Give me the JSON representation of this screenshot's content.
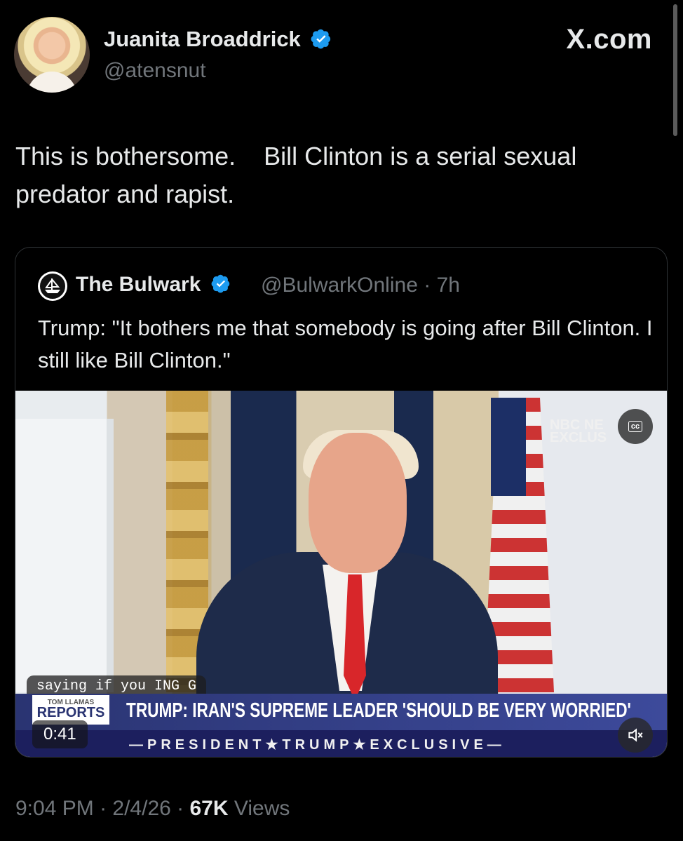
{
  "header": {
    "author_name": "Juanita Broaddrick",
    "author_handle": "@atensnut",
    "site_watermark": "X.com"
  },
  "tweet": {
    "text": "This is bothersome.    Bill Clinton is a serial sexual predator and rapist."
  },
  "quoted_tweet": {
    "author_name": "The Bulwark",
    "author_handle": "@BulwarkOnline",
    "time_ago": "7h",
    "text": "Trump: \"It bothers me that somebody is going after Bill Clinton. I still like Bill Clinton.\"",
    "video": {
      "network_bug": "NBC NE\nEXCLUS",
      "cc_label": "cc",
      "caption": "saying if you ING G",
      "show_label": "REPORTS",
      "show_label_small": "TOM LLAMAS",
      "headline": "TRUMP: IRAN'S SUPREME LEADER 'SHOULD BE VERY WORRIED'",
      "bottom_banner": "—PRESIDENT★TRUMP★EXCLUSIVE—",
      "timer": "0:41",
      "mute_icon": "speaker-muted-icon"
    }
  },
  "meta": {
    "time": "9:04 PM",
    "date": "2/4/26",
    "views_count": "67K",
    "views_label": "Views"
  },
  "colors": {
    "verified_blue": "#1d9bf0",
    "secondary_text": "#71767b",
    "primary_text": "#e7e9ea"
  }
}
